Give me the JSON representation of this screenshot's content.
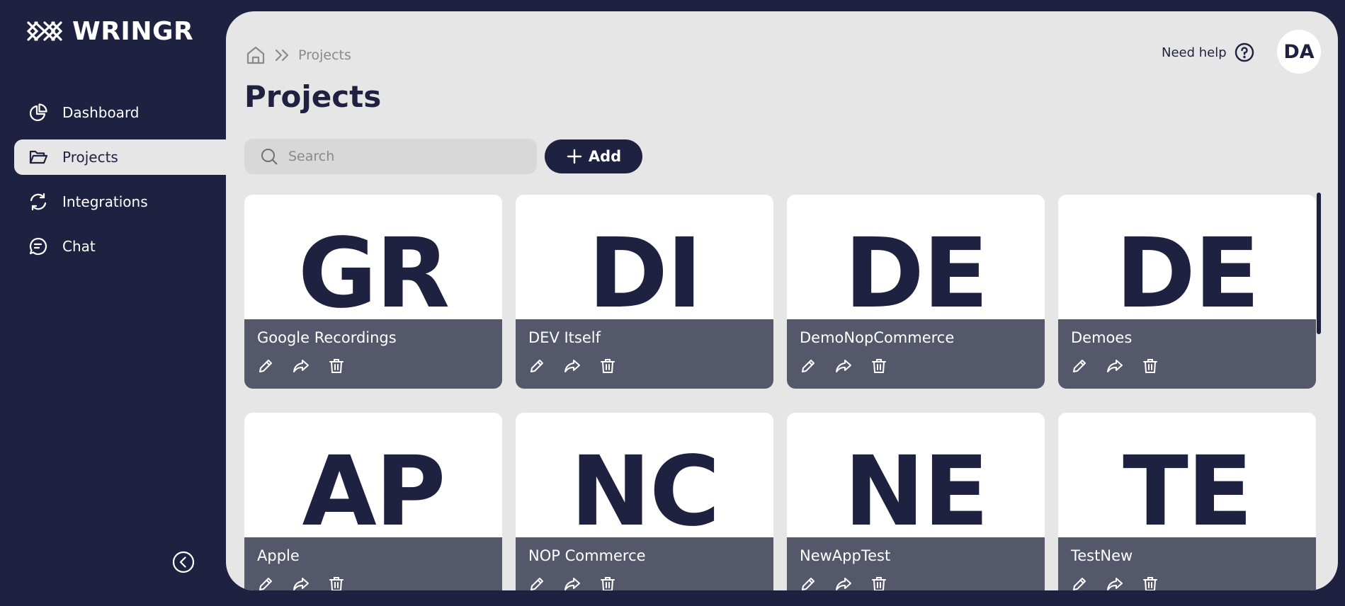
{
  "app": {
    "brand_name": "WRINGR",
    "logo_icon": "wringr-logo-icon"
  },
  "colors": {
    "navy": "#1f2140",
    "panel": "#e6e6e6",
    "card_footer": "#55586b",
    "white": "#ffffff"
  },
  "sidebar": {
    "items": [
      {
        "label": "Dashboard",
        "icon": "pie-chart-icon",
        "active": false
      },
      {
        "label": "Projects",
        "icon": "folder-open-icon",
        "active": true
      },
      {
        "label": "Integrations",
        "icon": "refresh-icon",
        "active": false
      },
      {
        "label": "Chat",
        "icon": "chat-bubble-icon",
        "active": false
      }
    ],
    "collapse_icon": "chevron-left-circle-icon"
  },
  "header": {
    "breadcrumb": {
      "home_icon": "home-icon",
      "separator_icon": "double-chevron-right-icon",
      "current": "Projects"
    },
    "title": "Projects",
    "help_label": "Need help",
    "help_icon": "question-circle-icon",
    "avatar_initials": "DA"
  },
  "toolbar": {
    "search_placeholder": "Search",
    "search_value": "",
    "search_icon": "search-icon",
    "add_label": "Add",
    "add_icon": "plus-icon"
  },
  "projects": [
    {
      "initials": "GR",
      "name": "Google Recordings"
    },
    {
      "initials": "DI",
      "name": "DEV Itself"
    },
    {
      "initials": "DE",
      "name": "DemoNopCommerce"
    },
    {
      "initials": "DE",
      "name": "Demoes"
    },
    {
      "initials": "AP",
      "name": "Apple"
    },
    {
      "initials": "NC",
      "name": "NOP Commerce"
    },
    {
      "initials": "NE",
      "name": "NewAppTest"
    },
    {
      "initials": "TE",
      "name": "TestNew"
    }
  ],
  "card_actions": [
    "pencil-icon",
    "share-arrow-icon",
    "trash-icon"
  ]
}
